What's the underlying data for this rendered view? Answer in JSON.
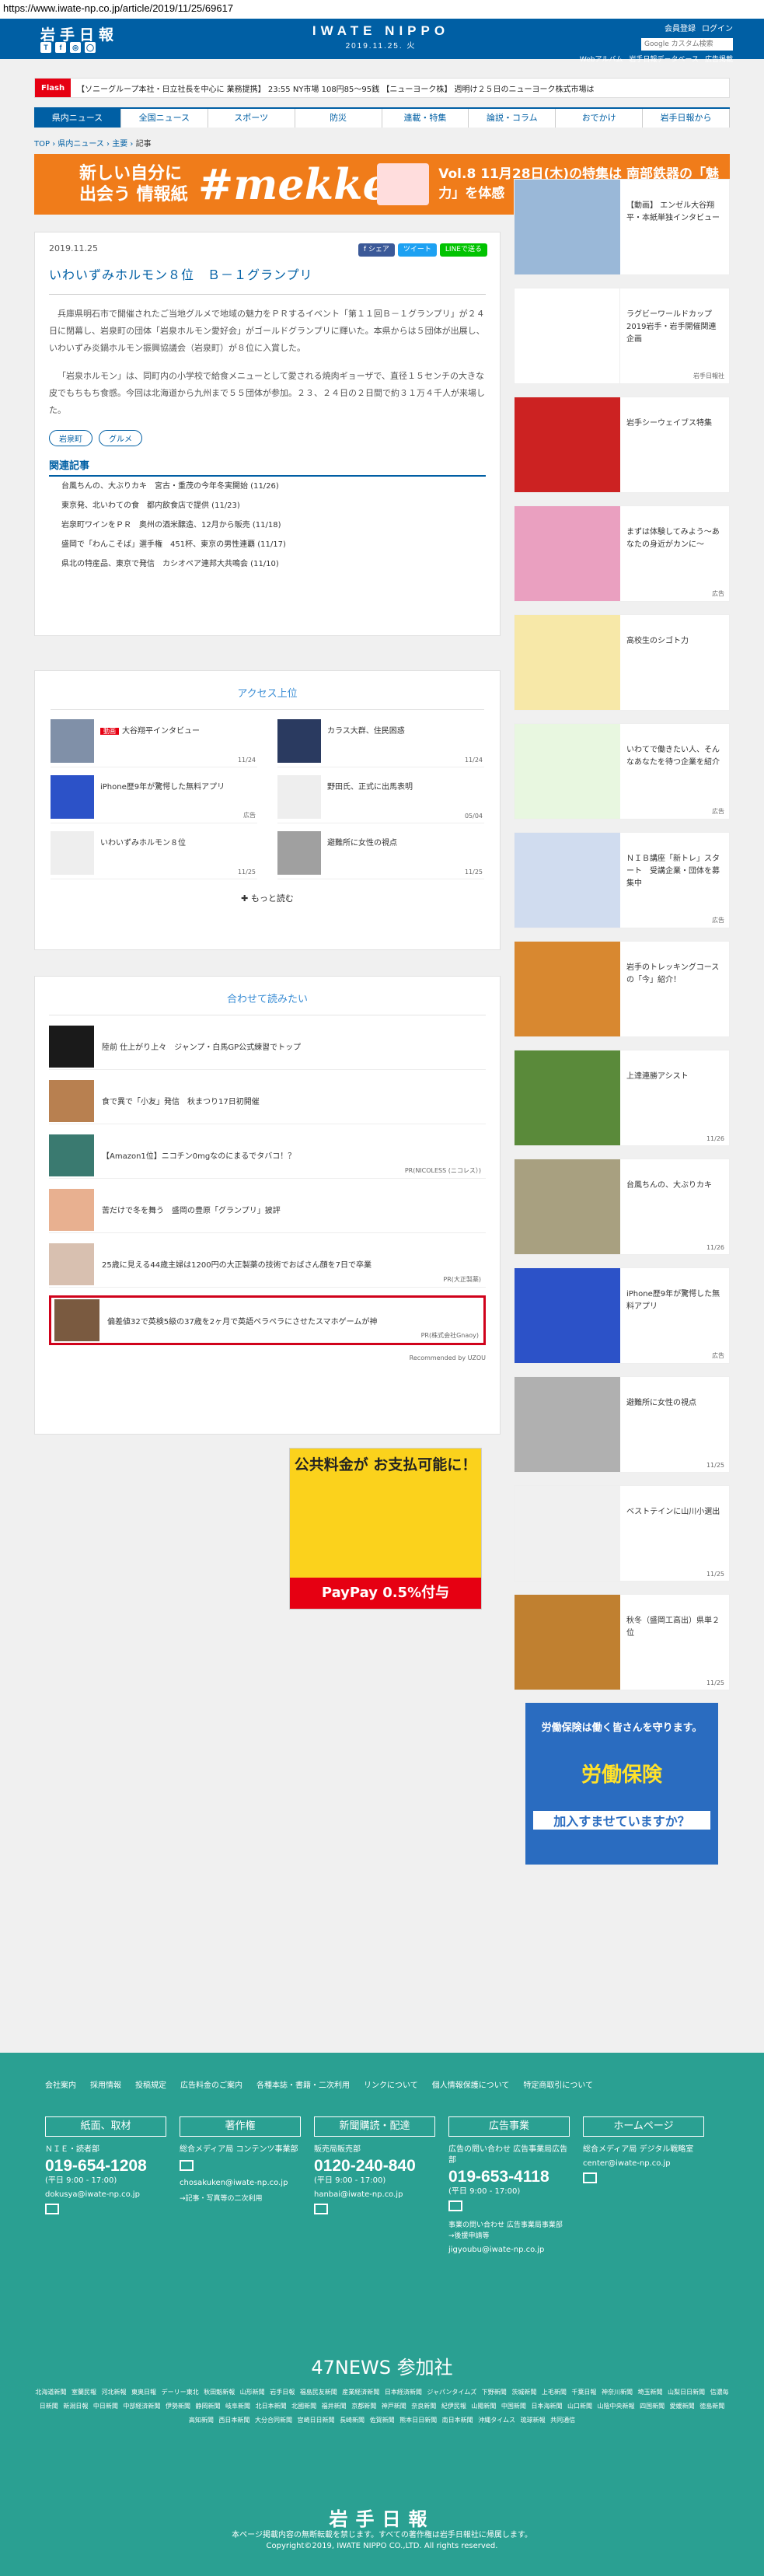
{
  "browser": {
    "url": "https://www.iwate-np.co.jp/article/2019/11/25/69617"
  },
  "header": {
    "logo": "岩手日報",
    "social": [
      "T",
      "f",
      "◎",
      "◯"
    ],
    "site_name": "IWATE NIPPO",
    "date": "2019.11.25. 火",
    "links": [
      "会員登録",
      "ログイン"
    ],
    "search_placeholder": "Google カスタム検索",
    "sub_links": [
      "Webアルバム",
      "岩手日報データベース",
      "広告掲載"
    ]
  },
  "ticker": {
    "label": "Flash",
    "text": "【ソニーグループ本社・日立社長を中心に 業務提携】 23:55 NY市場 108円85〜95銭 【ニューヨーク株】 週明け２５日のニューヨーク株式市場は"
  },
  "nav": [
    "県内ニュース",
    "全国ニュース",
    "スポーツ",
    "防災",
    "連載・特集",
    "論説・コラム",
    "おでかけ",
    "岩手日報から"
  ],
  "breadcrumb": {
    "top": "TOP",
    "sep": " › ",
    "section": "県内ニュース",
    "sub": "主要",
    "current": "記事"
  },
  "banner": {
    "left": "新しい自分に出会う 情報紙",
    "mid": "#mekke",
    "vol": "Vol.8",
    "text": "11月28日(木)の特集は 南部鉄器の「魅力」を体感"
  },
  "article": {
    "date": "2019.11.25",
    "share": [
      "f シェア",
      "ツイート",
      "LINEで送る"
    ],
    "title": "いわいずみホルモン８位　Ｂ－１グランプリ",
    "p1": "兵庫県明石市で開催されたご当地グルメで地域の魅力をＰＲするイベント「第１１回Ｂ－１グランプリ」が２４日に閉幕し、岩泉町の団体「岩泉ホルモン愛好会」がゴールドグランプリに輝いた。本県からは５団体が出展し、いわいずみ炎鍋ホルモン振興協議会（岩泉町）が８位に入賞した。",
    "p2": "「岩泉ホルモン」は、同町内の小学校で給食メニューとして愛される焼肉ギョーザで、直径１５センチの大きな皮でもちもち食感。今回は北海道から九州まで５５団体が参加。２３、２４日の２日間で約３１万４千人が来場した。",
    "tags": [
      "岩泉町",
      "グルメ"
    ],
    "related_h": "関連記事",
    "related": [
      "台風ちんの、大ぶりカキ　宮古・重茂の今年冬実開始 (11/26)",
      "東京発、北いわての食　都内飲食店で提供 (11/23)",
      "岩泉町ワインをＰＲ　奥州の酒米醸造、12月から販売 (11/18)",
      "盛岡で「わんこそば」選手権　451杯、東京の男性連覇 (11/17)",
      "県北の特産品、東京で発信　カシオペア連邦大共鳴会 (11/10)"
    ]
  },
  "ranking": {
    "title": "アクセス上位",
    "items": [
      {
        "badge": "動画",
        "title": "大谷翔平インタビュー",
        "date": "11/24"
      },
      {
        "badge": "",
        "title": "カラス大群、住民困惑",
        "date": "11/24"
      },
      {
        "badge": "",
        "title": "iPhone歴9年が驚愕した無料アプリ",
        "date": "広告"
      },
      {
        "badge": "",
        "title": "野田氏、正式に出馬表明",
        "date": "05/04"
      },
      {
        "badge": "",
        "title": "いわいずみホルモン８位",
        "date": "11/25"
      },
      {
        "badge": "",
        "title": "避難所に女性の視点",
        "date": "11/25"
      }
    ],
    "more": "✚ もっと読む"
  },
  "recommend": {
    "title": "合わせて読みたい",
    "items": [
      {
        "title": "陸前 仕上がり上々　ジャンプ・白馬GP公式練習でトップ",
        "src": ""
      },
      {
        "title": "食で異で「小友」発信　秋まつり17日初開催",
        "src": ""
      },
      {
        "title": "【Amazon1位】ニコチン0mgなのにまるでタバコ！？",
        "src": "PR(NICOLESS (ニコレス）)"
      },
      {
        "title": "苦だけで冬を舞う　盛岡の豊原「グランプリ」披評",
        "src": ""
      },
      {
        "title": "25歳に見える44歳主婦は1200円の大正製薬の技術でおばさん顔を7日で卒業",
        "src": "PR(大正製薬)"
      },
      {
        "title": "偏差値32で英検5級の37歳を2ヶ月で英語ペラペラにさせたスマホゲームが神",
        "src": "PR(株式会社Gnaoy)"
      }
    ],
    "powered": "Recommended by UZOU"
  },
  "ad1": {
    "headline": "公共料金が お支払可能に！",
    "foot": "PayPay 0.5%付与"
  },
  "sidebar": [
    {
      "title": "【動画】 エンゼル大谷翔平・本紙単独インタビュー",
      "date": "",
      "color": "#9ab8d8"
    },
    {
      "title": "ラグビーワールドカップ2019岩手・岩手開催関連企画",
      "date": "岩手日報社",
      "color": "#ffffff"
    },
    {
      "title": "岩手シーウェイブス特集",
      "date": "",
      "color": "#cc2222"
    },
    {
      "title": "まずは体験してみよう～あなたの身近がカンに～",
      "date": "広告",
      "color": "#eaa0c0"
    },
    {
      "title": "高校生のシゴト力",
      "date": "",
      "color": "#f7e8a8"
    },
    {
      "title": "いわてで働きたい人、そんなあなたを待つ企業を紹介",
      "date": "広告",
      "color": "#e8f7e0"
    },
    {
      "title": "ＮＩＢ講座「新トレ」スタート　受講企業・団体を募集中",
      "date": "広告",
      "color": "#d0dcef"
    },
    {
      "title": "岩手のトレッキングコースの「今」紹介！",
      "date": "",
      "color": "#d88830"
    },
    {
      "title": "上達連勝アシスト",
      "date": "11/26",
      "color": "#5a8a3a"
    },
    {
      "title": "台風ちんの、大ぶりカキ",
      "date": "11/26",
      "color": "#a8a080"
    },
    {
      "title": "iPhone歴9年が驚愕した無料アプリ",
      "date": "広告",
      "color": "#ffffff"
    },
    {
      "title": "避難所に女性の視点",
      "date": "11/25",
      "color": "#b0b0b0"
    },
    {
      "title": "ベストテインに山川小選出",
      "date": "11/25",
      "color": "#f0f0f0"
    },
    {
      "title": "秋冬（盛岡工高出）県単２位",
      "date": "11/25",
      "color": "#c08030"
    }
  ],
  "side_ad": {
    "a": "労働保険は働く皆さんを守ります。",
    "b": "労働保険",
    "c": "加入すませていますか？"
  },
  "footer": {
    "links": [
      "会社案内",
      "採用情報",
      "投稿規定",
      "広告料金のご案内",
      "各種本誌・書籍・二次利用",
      "リンクについて",
      "個人情報保護について",
      "特定商取引について"
    ],
    "cols": [
      {
        "head": "紙面、取材",
        "sub": "ＮＩＥ・読者部",
        "tel": "019-654-1208",
        "hours": "(平日 9:00 - 17:00)",
        "mail": "dokusya@iwate-np.co.jp",
        "extra": ""
      },
      {
        "head": "著作権",
        "sub": "総合メディア局 コンテンツ事業部",
        "tel": "",
        "hours": "",
        "mail": "chosakuken@iwate-np.co.jp",
        "extra": "→記事・写真等の二次利用"
      },
      {
        "head": "新聞購読・配達",
        "sub": "販売局販売部",
        "tel": "0120-240-840",
        "hours": "(平日 9:00 - 17:00)",
        "mail": "hanbai@iwate-np.co.jp",
        "extra": ""
      },
      {
        "head": "広告事業",
        "sub": "広告の問い合わせ 広告事業局広告部",
        "tel": "019-653-4118",
        "hours": "(平日 9:00 - 17:00)",
        "mail": "jigyoubu@iwate-np.co.jp",
        "extra": "事業の問い合わせ 広告事業局事業部 →後援申請等"
      },
      {
        "head": "ホームページ",
        "sub": "総合メディア局 デジタル戦略室",
        "tel": "",
        "hours": "",
        "mail": "center@iwate-np.co.jp",
        "extra": ""
      }
    ],
    "n47": "47NEWS 参加社",
    "n47list": "北海道新聞 室蘭民報 河北新報 東奥日報 デーリー東北 秋田魁新報 山形新聞 岩手日報 福島民友新聞 産業経済新聞 日本経済新聞 ジャパンタイムズ 下野新聞 茨城新聞 上毛新聞 千葉日報 神奈川新聞 埼玉新聞 山梨日日新聞 信濃毎日新聞 新潟日報 中日新聞 中部経済新聞 伊勢新聞 静岡新聞 岐阜新聞 北日本新聞 北國新聞 福井新聞 京都新聞 神戸新聞 奈良新聞 紀伊民報 山陽新聞 中国新聞 日本海新聞 山口新聞 山陰中央新報 四国新聞 愛媛新聞 徳島新聞 高知新聞 西日本新聞 大分合同新聞 宮崎日日新聞 長崎新聞 佐賀新聞 熊本日日新聞 南日本新聞 沖縄タイムス 琉球新報 共同通信",
    "logo": "岩手日報",
    "copy1": "本ページ掲載内容の無断転載を禁じます。すべての著作権は岩手日報社に帰属します。",
    "copy2": "Copyright©2019, IWATE NIPPO CO.,LTD. All rights reserved."
  }
}
